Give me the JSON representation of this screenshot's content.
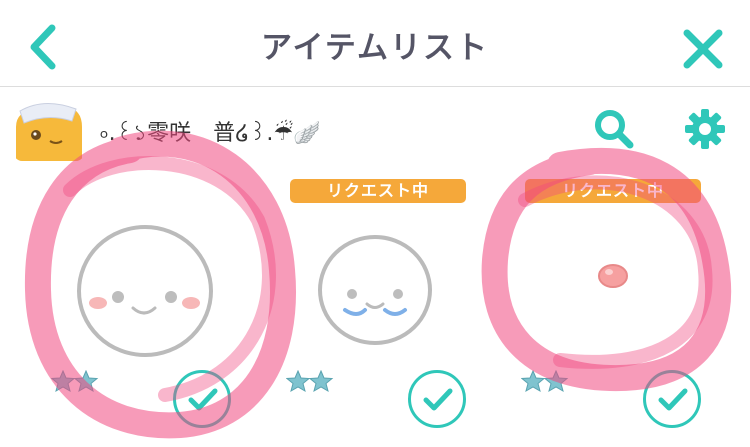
{
  "header": {
    "title": "アイテムリスト",
    "back_icon": "chevron-left-icon",
    "close_icon": "close-icon"
  },
  "user": {
    "name": "৹.꒰১零咲　普໒꒱.☔🪽",
    "avatar_icon": "mascot-avatar-icon"
  },
  "toolbar": {
    "search_icon": "search-icon",
    "settings_icon": "gear-icon"
  },
  "items": [
    {
      "badge": "",
      "rating_stars": 2,
      "face": "plain-face",
      "checked": true
    },
    {
      "badge": "リクエスト中",
      "rating_stars": 2,
      "face": "blush-face",
      "checked": true
    },
    {
      "badge": "リクエスト中",
      "rating_stars": 2,
      "face": "nose-only",
      "checked": true
    }
  ],
  "colors": {
    "accent": "#2fc7b9",
    "badge": "#f5a83a",
    "title": "#555566",
    "scribble": "#f0487f"
  }
}
